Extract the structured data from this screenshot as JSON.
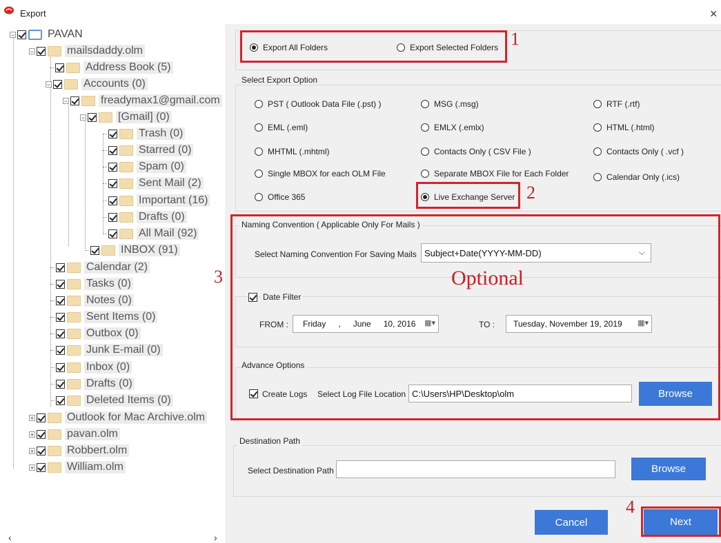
{
  "window": {
    "title": "Export",
    "close": "×"
  },
  "tree": {
    "root": "PAVAN",
    "olm_file": "mailsdaddy.olm",
    "address_book": "Address Book (5)",
    "accounts": "Accounts (0)",
    "account_email": "freadymax1@gmail.com",
    "gmail": "[Gmail] (0)",
    "gmail_children": [
      "Trash (0)",
      "Starred (0)",
      "Spam (0)",
      "Sent Mail (2)",
      "Important (16)",
      "Drafts (0)",
      "All Mail (92)"
    ],
    "inbox_account": "INBOX (91)",
    "folders": [
      "Calendar (2)",
      "Tasks (0)",
      "Notes (0)",
      "Sent Items (0)",
      "Outbox (0)",
      "Junk E-mail (0)",
      "Inbox (0)",
      "Drafts (0)",
      "Deleted Items (0)"
    ],
    "other_files": [
      "Outlook for Mac Archive.olm",
      "pavan.olm",
      "Robbert.olm",
      "William.olm"
    ]
  },
  "scroll": {
    "left": "‹",
    "right": "›"
  },
  "export_scope": {
    "all": "Export All Folders",
    "selected": "Export Selected Folders",
    "selected_value": "all"
  },
  "export_option": {
    "title": "Select Export Option",
    "options": [
      "PST ( Outlook Data File (.pst) )",
      "MSG (.msg)",
      "RTF (.rtf)",
      "EML (.eml)",
      "EMLX (.emlx)",
      "HTML (.html)",
      "MHTML (.mhtml)",
      "Contacts Only ( CSV File )",
      "Contacts Only ( .vcf )",
      "Single MBOX for each OLM File",
      "Separate MBOX File for Each Folder",
      "Calendar Only (.ics)",
      "Office 365",
      "Live Exchange Server"
    ],
    "selected": "Live Exchange Server"
  },
  "naming": {
    "title": "Naming Convention ( Applicable Only For Mails )",
    "label": "Select Naming Convention For Saving Mails",
    "value": "Subject+Date(YYYY-MM-DD)"
  },
  "date_filter": {
    "label": "Date Filter",
    "checked": true,
    "from_label": "FROM :",
    "from": {
      "day": "Friday",
      "sep": ",",
      "month": "June",
      "date": "10, 2016"
    },
    "to_label": "TO :",
    "to": {
      "day": "Tuesday",
      "rest": ", November 19, 2019"
    }
  },
  "advance": {
    "title": "Advance Options",
    "create_logs": "Create Logs",
    "log_label": "Select Log File Location :",
    "log_path": "C:\\Users\\HP\\Desktop\\olm",
    "browse": "Browse"
  },
  "destination": {
    "title": "Destination Path",
    "label": "Select Destination Path",
    "value": "",
    "browse": "Browse"
  },
  "buttons": {
    "cancel": "Cancel",
    "next": "Next"
  },
  "annotations": {
    "n1": "1",
    "n2": "2",
    "n3": "3",
    "n4": "4",
    "optional": "Optional"
  },
  "colors": {
    "accent": "#3b78d8",
    "annotation": "#d4232b",
    "folder": "#f3ddb0"
  }
}
